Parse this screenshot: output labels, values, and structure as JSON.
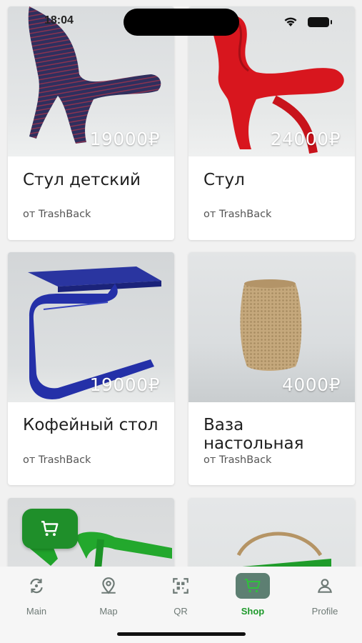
{
  "status_bar": {
    "time": "18:04"
  },
  "products": [
    {
      "price": "19000₽",
      "title": "Стул детский",
      "seller": "от TrashBack"
    },
    {
      "price": "24000₽",
      "title": "Стул",
      "seller": "от TrashBack"
    },
    {
      "price": "19000₽",
      "title": "Кофейный стол",
      "seller": "от TrashBack"
    },
    {
      "price": "4000₽",
      "title": "Ваза настольная",
      "seller": "от TrashBack"
    }
  ],
  "cart_fab": {
    "icon": "cart-icon"
  },
  "nav": {
    "items": [
      {
        "label": "Main",
        "icon": "refresh-icon"
      },
      {
        "label": "Map",
        "icon": "map-pin-icon"
      },
      {
        "label": "QR",
        "icon": "qr-scan-icon"
      },
      {
        "label": "Shop",
        "icon": "cart-icon"
      },
      {
        "label": "Profile",
        "icon": "user-icon"
      }
    ],
    "active": "Shop"
  },
  "colors": {
    "accent": "#1f9a2c",
    "fab": "#1f8f2a",
    "active_nav_bg": "#5d7f72"
  }
}
